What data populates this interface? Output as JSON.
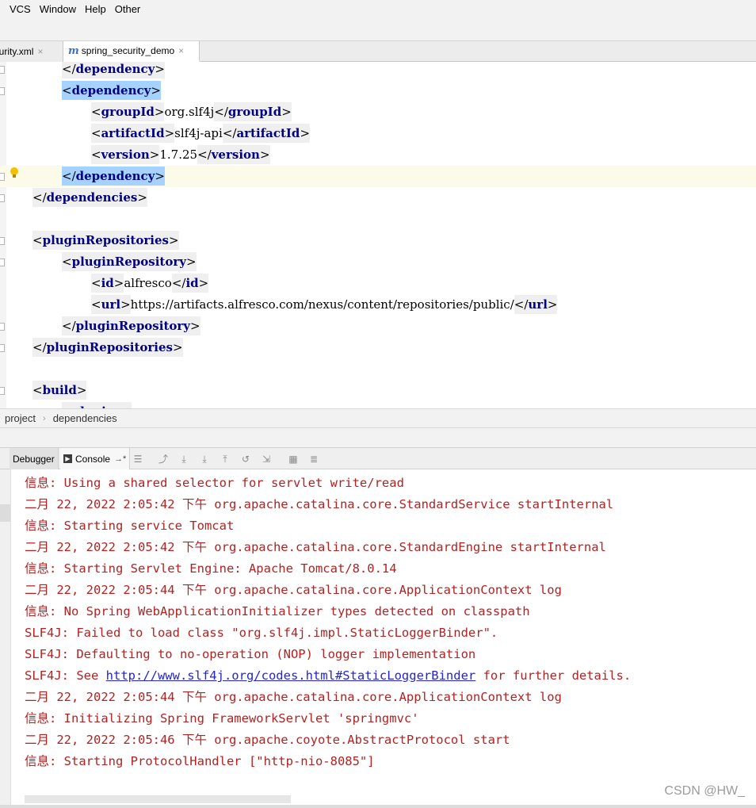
{
  "menu": [
    "VCS",
    "Window",
    "Help",
    "Other"
  ],
  "tabs": [
    {
      "label": "ecurity.xml",
      "close": "×"
    },
    {
      "icon": "m",
      "label": "spring_security_demo",
      "close": "×"
    }
  ],
  "editor": {
    "lines": [
      {
        "indent": 2,
        "segments": [
          {
            "t": "</"
          },
          {
            "n": "dependency"
          },
          {
            "t": ">"
          }
        ]
      },
      {
        "indent": 2,
        "hl": true,
        "segments": [
          {
            "t": "<"
          },
          {
            "n": "dependency"
          },
          {
            "t": ">"
          }
        ]
      },
      {
        "indent": 3,
        "segments": [
          {
            "t": "<"
          },
          {
            "n": "groupId"
          },
          {
            "t": ">"
          }
        ],
        "text": "org.slf4j",
        "close": [
          {
            "t": "</"
          },
          {
            "n": "groupId"
          },
          {
            "t": ">"
          }
        ]
      },
      {
        "indent": 3,
        "segments": [
          {
            "t": "<"
          },
          {
            "n": "artifactId"
          },
          {
            "t": ">"
          }
        ],
        "text": "slf4j-api",
        "close": [
          {
            "t": "</"
          },
          {
            "n": "artifactId"
          },
          {
            "t": ">"
          }
        ]
      },
      {
        "indent": 3,
        "segments": [
          {
            "t": "<"
          },
          {
            "n": "version"
          },
          {
            "t": ">"
          }
        ],
        "text": "1.7.25",
        "close": [
          {
            "t": "</"
          },
          {
            "n": "version"
          },
          {
            "t": ">"
          }
        ]
      },
      {
        "indent": 2,
        "hl": true,
        "current": true,
        "segments": [
          {
            "t": "</"
          },
          {
            "n": "dependency"
          },
          {
            "t": ">"
          }
        ]
      },
      {
        "indent": 1,
        "segments": [
          {
            "t": "</"
          },
          {
            "n": "dependencies"
          },
          {
            "t": ">"
          }
        ]
      },
      {
        "indent": 0,
        "segments": []
      },
      {
        "indent": 1,
        "segments": [
          {
            "t": "<"
          },
          {
            "n": "pluginRepositories"
          },
          {
            "t": ">"
          }
        ]
      },
      {
        "indent": 2,
        "segments": [
          {
            "t": "<"
          },
          {
            "n": "pluginRepository"
          },
          {
            "t": ">"
          }
        ]
      },
      {
        "indent": 3,
        "segments": [
          {
            "t": "<"
          },
          {
            "n": "id"
          },
          {
            "t": ">"
          }
        ],
        "text": "alfresco",
        "close": [
          {
            "t": "</"
          },
          {
            "n": "id"
          },
          {
            "t": ">"
          }
        ]
      },
      {
        "indent": 3,
        "segments": [
          {
            "t": "<"
          },
          {
            "n": "url"
          },
          {
            "t": ">"
          }
        ],
        "text": "https://artifacts.alfresco.com/nexus/content/repositories/public/",
        "close": [
          {
            "t": "</"
          },
          {
            "n": "url"
          },
          {
            "t": ">"
          }
        ]
      },
      {
        "indent": 2,
        "segments": [
          {
            "t": "</"
          },
          {
            "n": "pluginRepository"
          },
          {
            "t": ">"
          }
        ]
      },
      {
        "indent": 1,
        "segments": [
          {
            "t": "</"
          },
          {
            "n": "pluginRepositories"
          },
          {
            "t": ">"
          }
        ]
      },
      {
        "indent": 0,
        "segments": []
      },
      {
        "indent": 1,
        "segments": [
          {
            "t": "<"
          },
          {
            "n": "build"
          },
          {
            "t": ">"
          }
        ]
      },
      {
        "indent": 2,
        "segments": [
          {
            "t": "<"
          },
          {
            "n": "plugins"
          },
          {
            "t": ">"
          }
        ]
      }
    ]
  },
  "breadcrumb": [
    "project",
    "dependencies"
  ],
  "debug": {
    "debugger_label": "Debugger",
    "console_label": "Console",
    "console_pin": "→*"
  },
  "console": {
    "lines": [
      {
        "text": "信息: Using a shared selector for servlet write/read"
      },
      {
        "text": "二月 22, 2022 2:05:42 下午 org.apache.catalina.core.StandardService startInternal"
      },
      {
        "text": "信息: Starting service Tomcat"
      },
      {
        "text": "二月 22, 2022 2:05:42 下午 org.apache.catalina.core.StandardEngine startInternal"
      },
      {
        "text": "信息: Starting Servlet Engine: Apache Tomcat/8.0.14"
      },
      {
        "text": "二月 22, 2022 2:05:44 下午 org.apache.catalina.core.ApplicationContext log"
      },
      {
        "text": "信息: No Spring WebApplicationInitializer types detected on classpath"
      },
      {
        "text": "SLF4J: Failed to load class \"org.slf4j.impl.StaticLoggerBinder\"."
      },
      {
        "text": "SLF4J: Defaulting to no-operation (NOP) logger implementation"
      },
      {
        "text": "SLF4J: See ",
        "link": "http://www.slf4j.org/codes.html#StaticLoggerBinder",
        "after": " for further details."
      },
      {
        "text": "二月 22, 2022 2:05:44 下午 org.apache.catalina.core.ApplicationContext log"
      },
      {
        "text": "信息: Initializing Spring FrameworkServlet 'springmvc'"
      },
      {
        "text": "二月 22, 2022 2:05:46 下午 org.apache.coyote.AbstractProtocol start"
      },
      {
        "text": "信息: Starting ProtocolHandler [\"http-nio-8085\"]"
      }
    ]
  },
  "watermark": "CSDN @HW_",
  "colors": {
    "tag_name": "#000080",
    "selection": "#a6d2ff",
    "current_line": "#fcfae8",
    "console_text": "#b22222",
    "console_link": "#2323d8"
  }
}
